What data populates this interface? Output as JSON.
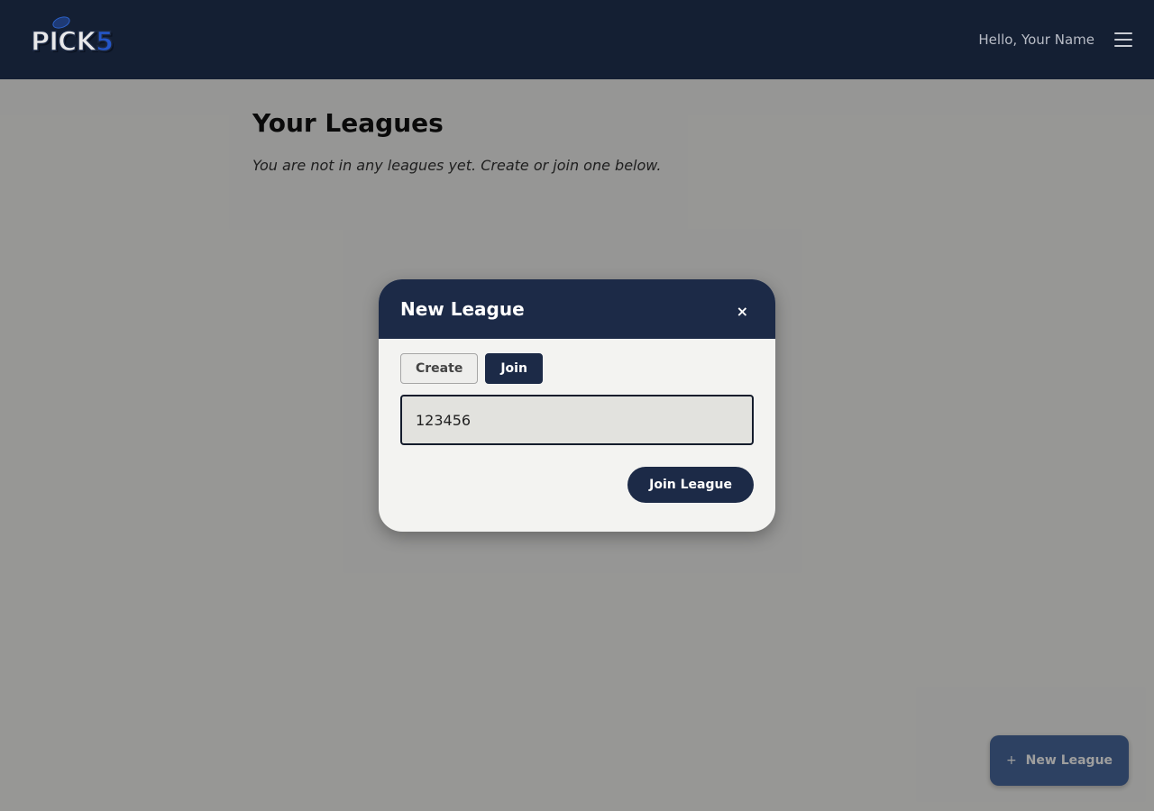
{
  "header": {
    "logo_text": "PICK",
    "logo_number": "5",
    "greeting": "Hello, Your Name"
  },
  "main": {
    "title": "Your Leagues",
    "empty_message": "You are not in any leagues yet. Create or join one below."
  },
  "modal": {
    "title": "New League",
    "close_label": "×",
    "tabs": [
      {
        "label": "Create",
        "active": false
      },
      {
        "label": "Join",
        "active": true
      }
    ],
    "code_input_value": "123456",
    "submit_label": "Join League"
  },
  "fab": {
    "icon": "+",
    "label": "New League"
  },
  "colors": {
    "header_bg": "#141f33",
    "primary": "#1c2a47",
    "logo_accent": "#2456c9",
    "page_bg": "#f3f3f1"
  }
}
